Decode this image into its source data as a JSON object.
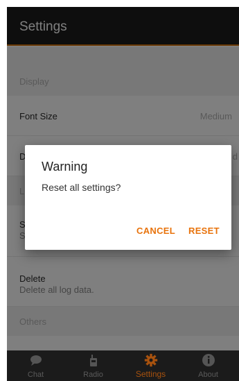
{
  "app_bar": {
    "title": "Settings"
  },
  "sections": {
    "display": {
      "header": "Display",
      "font_size": {
        "title": "Font Size",
        "value": "Medium"
      },
      "second_row": {
        "title_partial": "D",
        "value_partial": "d"
      }
    },
    "log": {
      "header_partial": "L",
      "first_row": {
        "title_partial": "S",
        "sub_partial": "S"
      },
      "delete": {
        "title": "Delete",
        "subtitle": "Delete all log data."
      }
    },
    "others": {
      "header": "Others"
    }
  },
  "dialog": {
    "title": "Warning",
    "message": "Reset all settings?",
    "cancel_label": "CANCEL",
    "reset_label": "RESET",
    "accent_color": "#e8730c"
  },
  "bottom_nav": {
    "items": [
      {
        "label": "Chat",
        "icon": "chat-bubble-icon"
      },
      {
        "label": "Radio",
        "icon": "radio-icon"
      },
      {
        "label": "Settings",
        "icon": "gear-icon",
        "active": true
      },
      {
        "label": "About",
        "icon": "info-icon"
      }
    ],
    "active_color": "#a8520e"
  }
}
